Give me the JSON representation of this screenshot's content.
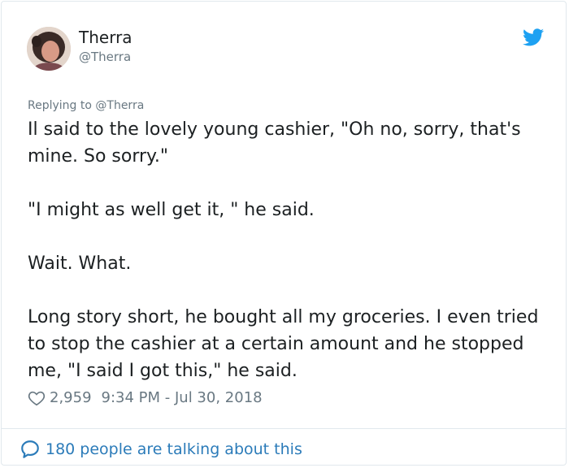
{
  "author": {
    "name": "Therra",
    "handle": "@Therra"
  },
  "reply": {
    "prefix": "Replying to ",
    "handle": "@Therra"
  },
  "tweet": {
    "paragraphs": [
      "Il said to the lovely young cashier, \"Oh no, sorry, that's mine. So sorry.\"",
      "\"I might as well get it, \" he said.",
      "Wait. What.",
      "Long story short, he bought all my groceries. I even tried to stop the cashier at a certain amount and he stopped me, \"I said I got this,\" he said."
    ]
  },
  "meta": {
    "likes": "2,959",
    "timestamp": "9:34 PM - Jul 30, 2018"
  },
  "footer": {
    "talking": "180 people are talking about this"
  },
  "icons": {
    "brand": "twitter-bird-icon",
    "like": "heart-icon",
    "conversation": "speech-bubble-icon"
  },
  "colors": {
    "brand": "#1da1f2",
    "link": "#2b7bb9",
    "muted": "#697882",
    "text": "#1c2022"
  }
}
